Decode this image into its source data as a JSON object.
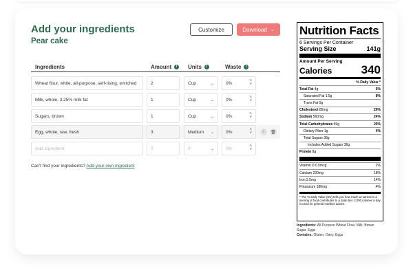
{
  "header": {
    "title": "Add your ingredients",
    "recipe_name": "Pear cake",
    "customize_label": "Customize",
    "download_label": "Download"
  },
  "table": {
    "columns": [
      "Ingredients",
      "Amount",
      "Units",
      "Waste"
    ],
    "rows": [
      {
        "ingredient": "Wheat flour, white, all-purpose, self-rising, enriched",
        "amount": "2",
        "unit": "Cup",
        "waste": "0%"
      },
      {
        "ingredient": "Milk, whole, 3.25% milk fat",
        "amount": "1",
        "unit": "Cup",
        "waste": "0%"
      },
      {
        "ingredient": "Sugars, brown",
        "amount": "1",
        "unit": "Cup",
        "waste": "0%"
      },
      {
        "ingredient": "Egg, whole, raw, fresh",
        "amount": "3",
        "unit": "Medium",
        "waste": "0%"
      }
    ],
    "new_row": {
      "ingredient_placeholder": "Add Ingredient",
      "amount_placeholder": "0",
      "unit_placeholder": "0",
      "waste_placeholder": "0%"
    }
  },
  "footer": {
    "cant_find": "Can't find your ingredients?",
    "add_own_link": "Add your own ingredient"
  },
  "nutrition": {
    "title": "Nutrition Facts",
    "servings": "6 Servings Per Container",
    "serving_size_label": "Serving Size",
    "serving_size_value": "141g",
    "amount_per_serving": "Amount Per Serving",
    "calories_label": "Calories",
    "calories_value": "340",
    "dv_header": "% Daily Value *",
    "lines": [
      {
        "name": "Total Fat",
        "amount": "4g",
        "dv": "5%",
        "style": "b"
      },
      {
        "name": "Saturated Fat",
        "amount": "1.5g",
        "dv": "8%",
        "style": "i1"
      },
      {
        "name": "Trans Fat",
        "amount": "0g",
        "dv": "",
        "style": "i1"
      },
      {
        "name": "Cholesterol",
        "amount": "85mg",
        "dv": "29%",
        "style": "b"
      },
      {
        "name": "Sodium",
        "amount": "560mg",
        "dv": "24%",
        "style": "b"
      },
      {
        "name": "Total Carbohydrates",
        "amount": "69g",
        "dv": "25%",
        "style": "b"
      },
      {
        "name": "Dietary Fiber",
        "amount": "1g",
        "dv": "4%",
        "style": "i1"
      },
      {
        "name": "Total Sugars",
        "amount": "38g",
        "dv": "",
        "style": "i1"
      },
      {
        "name": "Includes Added Sugars",
        "amount": "36g",
        "dv": "",
        "style": "i2"
      },
      {
        "name": "Protein",
        "amount": "8g",
        "dv": "",
        "style": "b"
      }
    ],
    "vitamins": [
      {
        "name": "Vitamin D",
        "amount": "0.5mcg",
        "dv": "2%"
      },
      {
        "name": "Calcium",
        "amount": "230mg",
        "dv": "18%"
      },
      {
        "name": "Iron",
        "amount": "2.5mg",
        "dv": "14%"
      },
      {
        "name": "Potassium",
        "amount": "180mg",
        "dv": "4%"
      }
    ],
    "footnote": "* The % Daily Value (DV) tells you how much a nutrient in a serving of food contributes to a daily diet. 2,000 calories a day is used for general nutrition advice."
  },
  "ingredient_list": {
    "ingredients_label": "Ingredients:",
    "ingredients_text": "All-Purpose Wheat Flour, Milk, Brown Sugar, Eggs",
    "contains_label": "Contains:",
    "contains_text": "Gluten, Dairy, Eggs"
  },
  "colors": {
    "brand_green": "#2e6b4f",
    "download_red": "#ef7a7a"
  }
}
